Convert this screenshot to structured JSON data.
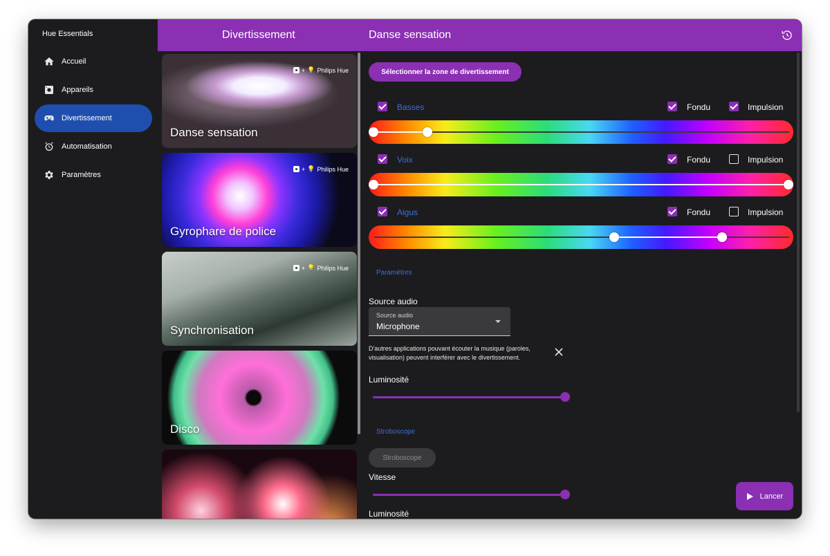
{
  "app": {
    "title": "Hue Essentials"
  },
  "sidebar": {
    "items": [
      {
        "label": "Accueil",
        "icon": "home-icon",
        "active": false
      },
      {
        "label": "Appareils",
        "icon": "device-icon",
        "active": false
      },
      {
        "label": "Divertissement",
        "icon": "gamepad-icon",
        "active": true
      },
      {
        "label": "Automatisation",
        "icon": "alarm-clock-icon",
        "active": false
      },
      {
        "label": "Paramètres",
        "icon": "gear-icon",
        "active": false
      }
    ]
  },
  "header": {
    "left_title": "Divertissement",
    "right_title": "Danse sensation",
    "history_icon": "history-icon"
  },
  "entertainment_list": {
    "cards": [
      {
        "label": "Danse sensation",
        "badge": "Philips Hue"
      },
      {
        "label": "Gyrophare de police",
        "badge": "Philips Hue"
      },
      {
        "label": "Synchronisation",
        "badge": "Philips Hue"
      },
      {
        "label": "Disco",
        "badge": ""
      },
      {
        "label": "",
        "badge": ""
      }
    ],
    "badge_plus": "+"
  },
  "detail": {
    "zone_button": "Sélectionner la zone de divertissement",
    "bands": [
      {
        "label": "Basses",
        "checked": true,
        "fade_label": "Fondu",
        "fade": true,
        "pulse_label": "Impulsion",
        "pulse": true,
        "range": [
          0,
          0.13
        ]
      },
      {
        "label": "Voix",
        "checked": true,
        "fade_label": "Fondu",
        "fade": true,
        "pulse_label": "Impulsion",
        "pulse": false,
        "range": [
          0,
          1
        ]
      },
      {
        "label": "Aigus",
        "checked": true,
        "fade_label": "Fondu",
        "fade": true,
        "pulse_label": "Impulsion",
        "pulse": false,
        "range": [
          0.58,
          0.84
        ]
      }
    ],
    "params_section": "Paramètres",
    "audio_source_label": "Source audio",
    "audio_select": {
      "small_label": "Source audio",
      "value": "Microphone"
    },
    "warning_text": "D'autres applications pouvant écouter la musique (paroles, visualisation) peuvent interférer avec le divertissement.",
    "brightness_label": "Luminosité",
    "brightness_value": 1.0,
    "strobe_section": "Stroboscope",
    "strobe_button": "Stroboscope",
    "speed_label": "Vitesse",
    "speed_value": 1.0,
    "brightness2_label": "Luminosité",
    "launch_button": "Lancer"
  },
  "colors": {
    "accent": "#8b2fb3",
    "active_nav": "#1f4fae",
    "link_blue": "#3d6fd8"
  }
}
